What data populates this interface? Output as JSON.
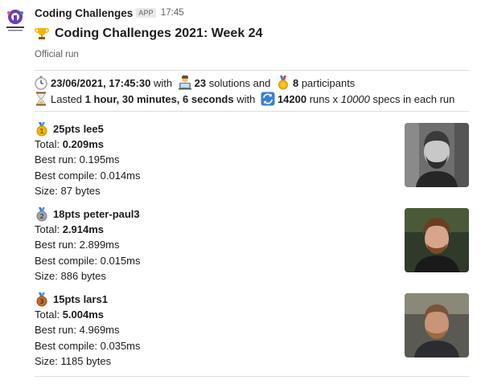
{
  "app": {
    "name": "Coding Challenges",
    "badge": "APP",
    "time": "17:45",
    "logo_icon": "coding-challenges-logo"
  },
  "message": {
    "title_icon": "trophy-icon",
    "title": "Coding Challenges 2021: Week 24",
    "subtitle": "Official run",
    "info": {
      "datetime": "23/06/2021, 17:45:30",
      "with1": " with ",
      "solutions_count": "23",
      "solutions_text": " solutions and ",
      "participants_count": "8",
      "participants_text": " participants",
      "lasted_label": "Lasted ",
      "duration": "1 hour, 30 minutes, 6 seconds",
      "with2": " with ",
      "runs_count": "14200",
      "runs_text": " runs x ",
      "specs_count": "10000",
      "specs_text": " specs in each run"
    }
  },
  "results": [
    {
      "medal": "gold-medal-icon",
      "headline": "25pts lee5",
      "total_label": "Total: ",
      "total": "0.209ms",
      "best_run": "Best run: 0.195ms",
      "best_compile": "Best compile: 0.014ms",
      "size": "Size: 87 bytes"
    },
    {
      "medal": "silver-medal-icon",
      "headline": "18pts peter-paul3",
      "total_label": "Total: ",
      "total": "2.914ms",
      "best_run": "Best run: 2.899ms",
      "best_compile": "Best compile: 0.015ms",
      "size": "Size: 886 bytes"
    },
    {
      "medal": "bronze-medal-icon",
      "headline": "15pts lars1",
      "total_label": "Total: ",
      "total": "5.004ms",
      "best_run": "Best run: 4.969ms",
      "best_compile": "Best compile: 0.035ms",
      "size": "Size: 1185 bytes"
    }
  ],
  "colors": {
    "gold": "#f2b500",
    "silver": "#a0a4a8",
    "bronze": "#c46a2b",
    "accent_blue": "#3b7fd1"
  }
}
